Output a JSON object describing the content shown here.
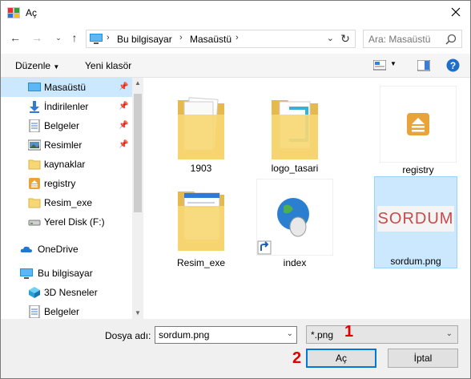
{
  "window": {
    "title": "Aç"
  },
  "nav": {
    "breadcrumb": [
      "Bu bilgisayar",
      "Masaüstü"
    ],
    "search_placeholder": "Ara: Masaüstü"
  },
  "toolbar": {
    "organize_label": "Düzenle",
    "new_folder_label": "Yeni klasör"
  },
  "sidebar": {
    "items": [
      {
        "label": "Masaüstü",
        "icon": "desktop-icon",
        "pinned": true,
        "selected": true
      },
      {
        "label": "İndirilenler",
        "icon": "download-icon",
        "pinned": true
      },
      {
        "label": "Belgeler",
        "icon": "document-icon",
        "pinned": true
      },
      {
        "label": "Resimler",
        "icon": "picture-icon",
        "pinned": true
      },
      {
        "label": "kaynaklar",
        "icon": "folder-icon"
      },
      {
        "label": "registry",
        "icon": "registry-icon"
      },
      {
        "label": "Resim_exe",
        "icon": "folder-icon"
      },
      {
        "label": "Yerel Disk (F:)",
        "icon": "drive-icon"
      },
      {
        "label": "OneDrive",
        "icon": "cloud-icon"
      },
      {
        "label": "Bu bilgisayar",
        "icon": "computer-icon"
      },
      {
        "label": "3D Nesneler",
        "icon": "3d-objects-icon"
      },
      {
        "label": "Belgeler",
        "icon": "document-icon"
      }
    ]
  },
  "files": [
    {
      "name": "1903",
      "type": "folder"
    },
    {
      "name": "logo_tasari",
      "type": "folder"
    },
    {
      "name": "registry",
      "type": "registry-file"
    },
    {
      "name": "Resim_exe",
      "type": "folder"
    },
    {
      "name": "index",
      "type": "shortcut"
    },
    {
      "name": "sordum.png",
      "type": "image",
      "selected": true,
      "thumb_text": "SORDUM"
    }
  ],
  "bottom": {
    "filename_label": "Dosya adı:",
    "filename_value": "sordum.png",
    "filter_value": "*.png",
    "open_label": "Aç",
    "cancel_label": "İptal",
    "marker_1": "1",
    "marker_2": "2"
  },
  "colors": {
    "accent": "#0078d7",
    "selection": "#cce8ff",
    "marker": "#e00000",
    "folder": "#f7d774"
  }
}
